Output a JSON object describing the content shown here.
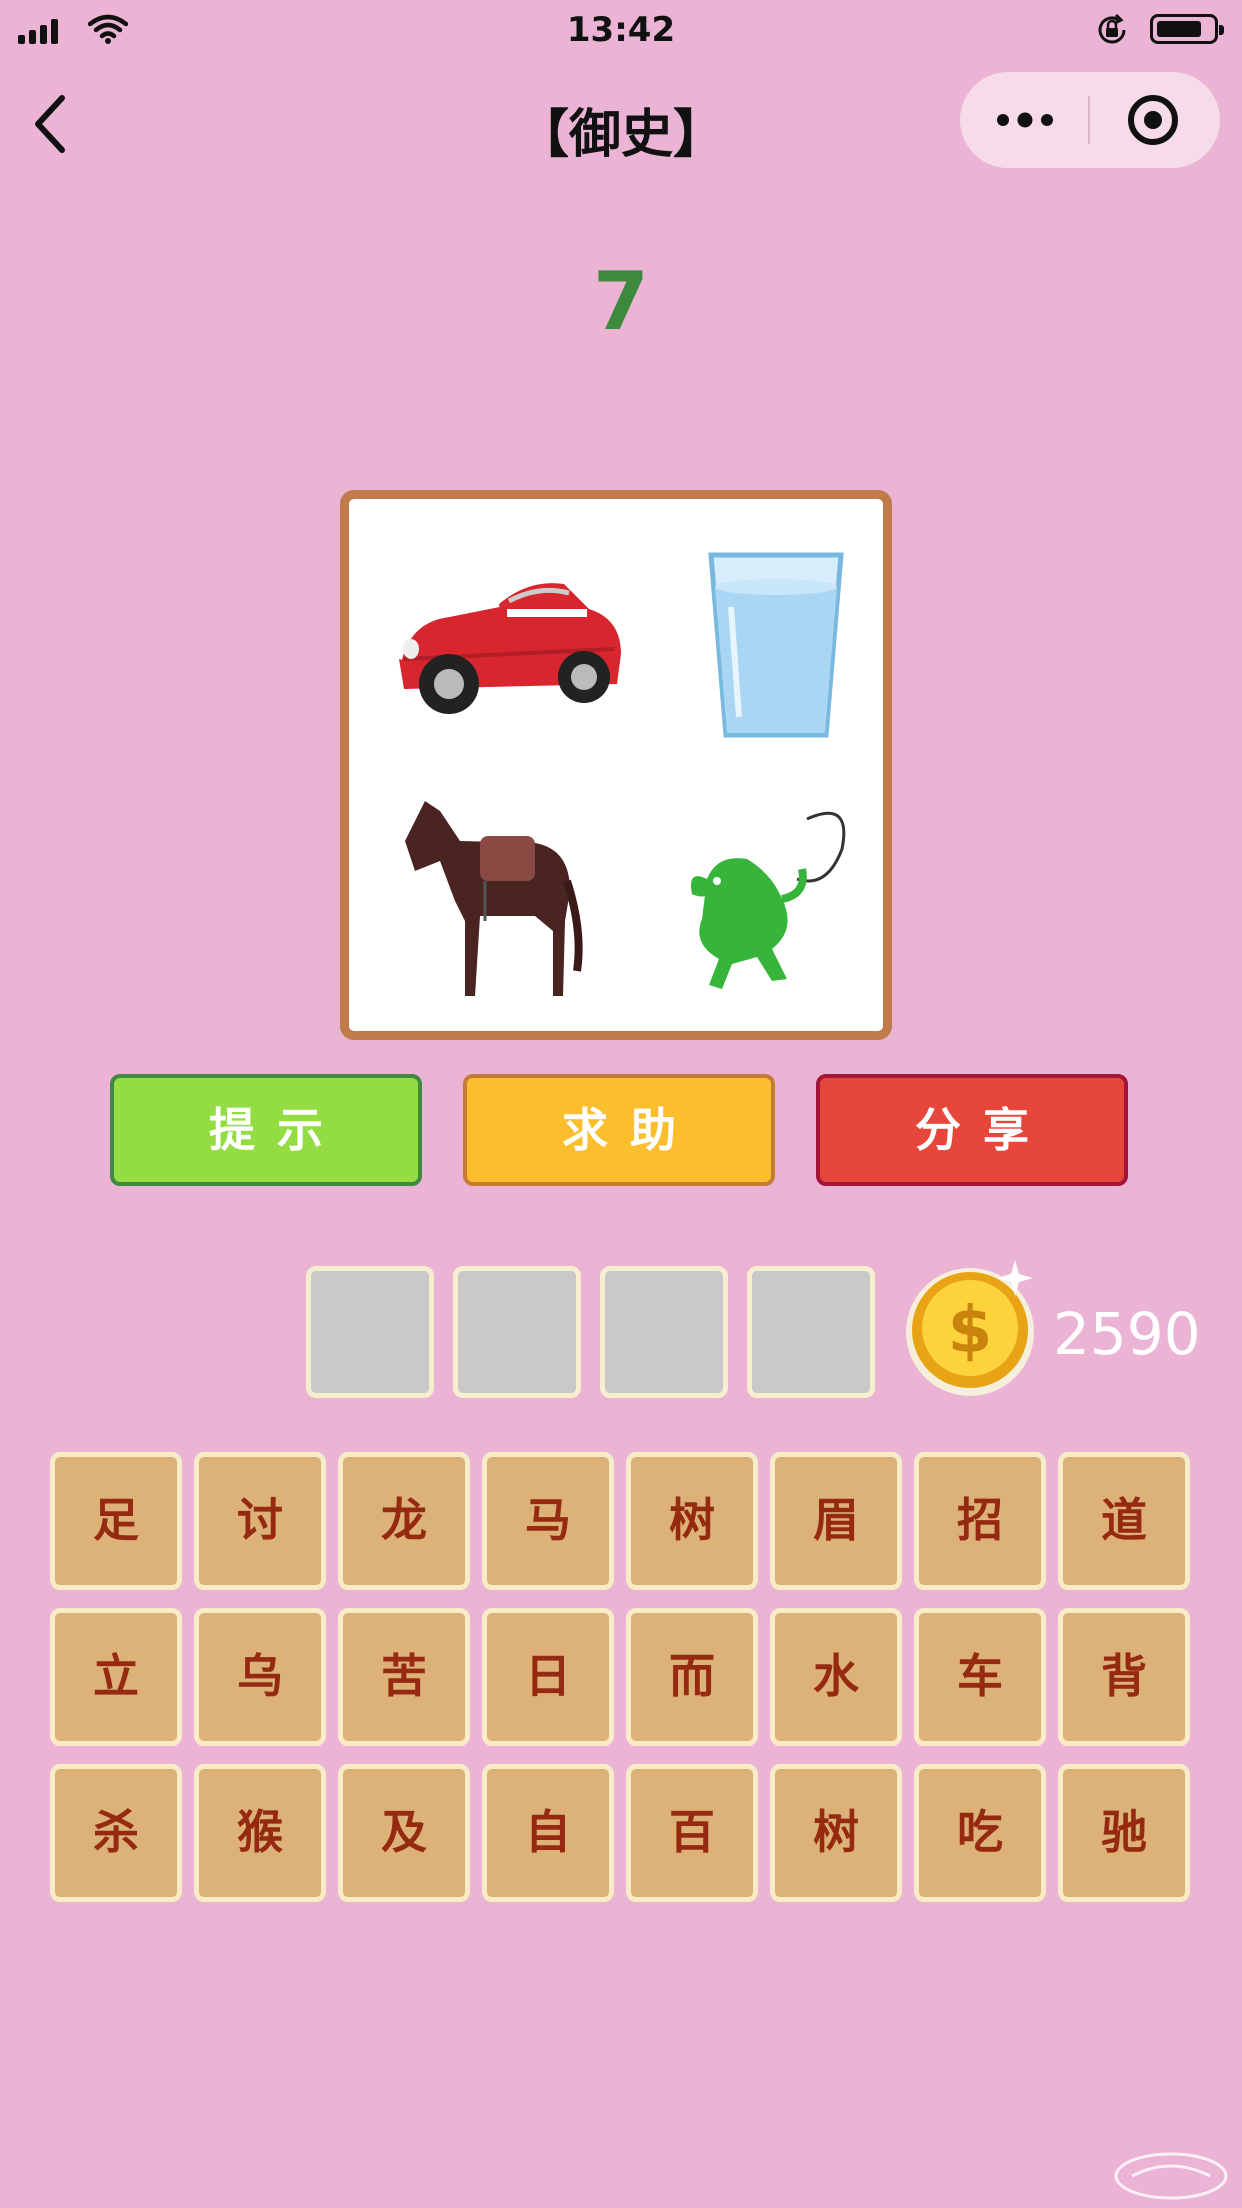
{
  "status_bar": {
    "time": "13:42"
  },
  "nav": {
    "title": "【御史】"
  },
  "level": "7",
  "puzzle": {
    "images": [
      "car-icon",
      "water-glass-icon",
      "horse-icon",
      "dragon-icon"
    ]
  },
  "buttons": {
    "hint": "提示",
    "help": "求助",
    "share": "分享"
  },
  "answer_slots": [
    "",
    "",
    "",
    ""
  ],
  "coins": "2590",
  "letters": [
    [
      "足",
      "讨",
      "龙",
      "马",
      "树",
      "眉",
      "招",
      "道"
    ],
    [
      "立",
      "乌",
      "苦",
      "日",
      "而",
      "水",
      "车",
      "背"
    ],
    [
      "杀",
      "猴",
      "及",
      "自",
      "百",
      "树",
      "吃",
      "驰"
    ]
  ],
  "colors": {
    "background": "#ebb3d4",
    "level_text": "#3d8a3f",
    "hint_button": "#94dc43",
    "help_button": "#fbbe2c",
    "share_button": "#e6473a",
    "tile": "#dcb279",
    "tile_text": "#962a10"
  }
}
